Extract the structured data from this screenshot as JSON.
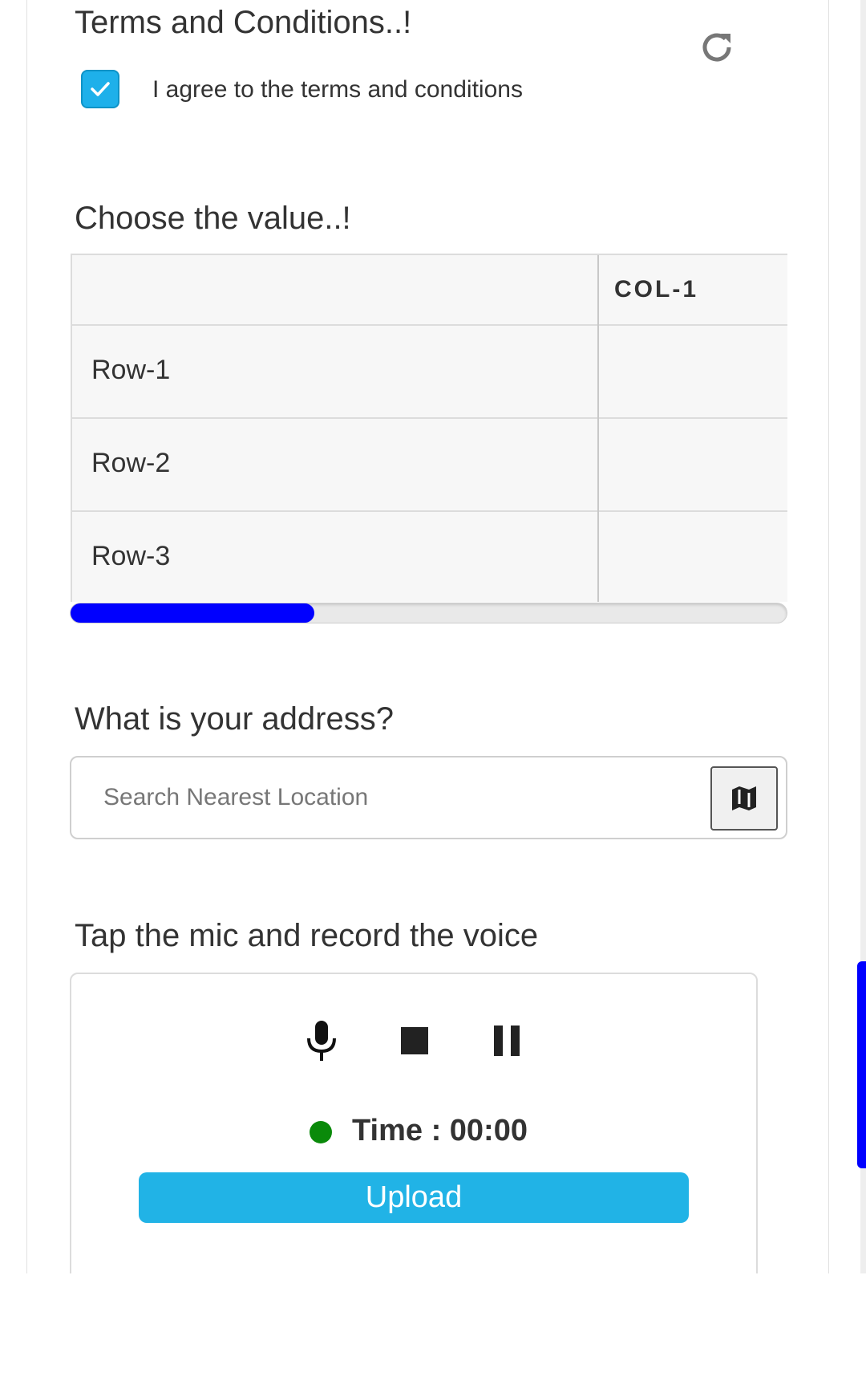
{
  "terms": {
    "title": "Terms and Conditions..!",
    "checkbox_label": "I agree to the terms and conditions",
    "checked": true,
    "refresh_icon": "refresh-icon"
  },
  "choice": {
    "title": "Choose the value..!",
    "columns": [
      "COL-1"
    ],
    "rows": [
      "Row-1",
      "Row-2",
      "Row-3"
    ],
    "scroll_progress": 0.34
  },
  "address": {
    "title": "What is your address?",
    "placeholder": "Search Nearest Location",
    "map_icon": "map-icon"
  },
  "voice": {
    "title": "Tap the mic and record the voice",
    "mic_icon": "mic-icon",
    "stop_icon": "stop-icon",
    "pause_icon": "pause-icon",
    "time_text": "Time : 00:00",
    "status_color": "#0a8a0a",
    "upload_label": "Upload",
    "upload_color": "#21b3e6"
  }
}
